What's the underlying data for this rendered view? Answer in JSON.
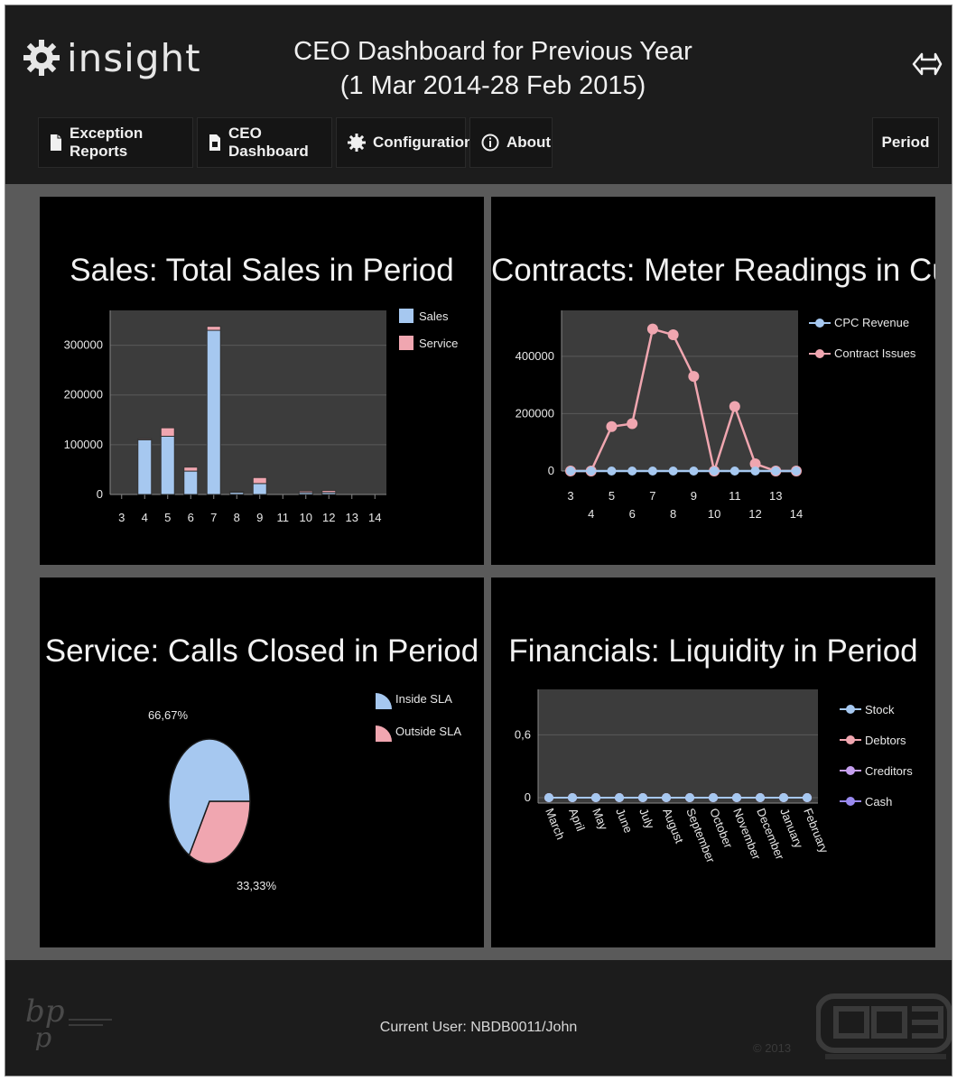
{
  "app": {
    "logo_text": "insight",
    "title_line1": "CEO Dashboard for Previous Year",
    "title_line2": "(1 Mar 2014-28 Feb 2015)"
  },
  "nav": {
    "items": [
      {
        "label": "Exception Reports",
        "icon": "document-icon"
      },
      {
        "label": "CEO Dashboard",
        "icon": "document-icon"
      },
      {
        "label": "Configuration",
        "icon": "gear-icon"
      },
      {
        "label": "About",
        "icon": "info-icon"
      }
    ],
    "period_label": "Period"
  },
  "panels": {
    "sales_title": "Sales: Total Sales in Period",
    "contracts_title": "Contracts: Meter Readings in Curre...",
    "service_title": "Service: Calls Closed in Period",
    "financials_title": "Financials: Liquidity in Period"
  },
  "colors": {
    "blue": "#a6c8f0",
    "pink": "#f0a6b0",
    "purple": "#c6a0f0",
    "violet": "#9a8af0",
    "plot_bg": "#3c3c3c"
  },
  "chart_data": [
    {
      "type": "bar",
      "title": "Sales: Total Sales in Period",
      "categories": [
        "3",
        "4",
        "5",
        "6",
        "7",
        "8",
        "9",
        "11",
        "10",
        "12",
        "13",
        "14"
      ],
      "series": [
        {
          "name": "Sales",
          "values": [
            0,
            110000,
            117000,
            47000,
            330000,
            5000,
            22000,
            0,
            4000,
            4000,
            0,
            0
          ]
        },
        {
          "name": "Service",
          "values": [
            0,
            2000,
            17000,
            8000,
            8000,
            1000,
            12000,
            0,
            3000,
            4000,
            0,
            0
          ]
        }
      ],
      "yticks": [
        0,
        100000,
        200000,
        300000
      ],
      "ylim": [
        0,
        370000
      ],
      "legend": "top-right"
    },
    {
      "type": "line",
      "title": "Contracts: Meter Readings in Curre...",
      "x": [
        3,
        4,
        5,
        6,
        7,
        8,
        9,
        10,
        11,
        12,
        13,
        14
      ],
      "series": [
        {
          "name": "CPC Revenue",
          "values": [
            0,
            0,
            0,
            0,
            0,
            0,
            0,
            0,
            0,
            0,
            0,
            0
          ]
        },
        {
          "name": "Contract Issues",
          "values": [
            0,
            0,
            155000,
            165000,
            495000,
            475000,
            330000,
            0,
            225000,
            25000,
            0,
            0
          ]
        }
      ],
      "yticks": [
        0,
        200000,
        400000
      ],
      "ylim": [
        0,
        560000
      ],
      "legend": "top-right"
    },
    {
      "type": "pie",
      "title": "Service: Calls Closed in Period",
      "slices": [
        {
          "name": "Inside SLA",
          "value": 66.67,
          "label": "66,67%"
        },
        {
          "name": "Outside SLA",
          "value": 33.33,
          "label": "33,33%"
        }
      ],
      "legend": "top-right"
    },
    {
      "type": "line",
      "title": "Financials: Liquidity in Period",
      "categories": [
        "March",
        "April",
        "May",
        "June",
        "July",
        "August",
        "September",
        "October",
        "November",
        "December",
        "January",
        "February"
      ],
      "series": [
        {
          "name": "Stock",
          "values": [
            0,
            0,
            0,
            0,
            0,
            0,
            0,
            0,
            0,
            0,
            0,
            0
          ]
        },
        {
          "name": "Debtors",
          "values": [
            0,
            0,
            0,
            0,
            0,
            0,
            0,
            0,
            0,
            0,
            0,
            0
          ]
        },
        {
          "name": "Creditors",
          "values": [
            0,
            0,
            0,
            0,
            0,
            0,
            0,
            0,
            0,
            0,
            0,
            0
          ]
        },
        {
          "name": "Cash",
          "values": [
            0,
            0,
            0,
            0,
            0,
            0,
            0,
            0,
            0,
            0,
            0,
            0
          ]
        }
      ],
      "yticks": [
        0,
        0.6
      ],
      "ytick_labels": [
        "0",
        "0,6"
      ],
      "ylim": [
        0,
        1
      ],
      "legend": "top-right"
    }
  ],
  "footer": {
    "current_user": "Current User: NBDB0011/John",
    "copyright": "© 2013"
  }
}
